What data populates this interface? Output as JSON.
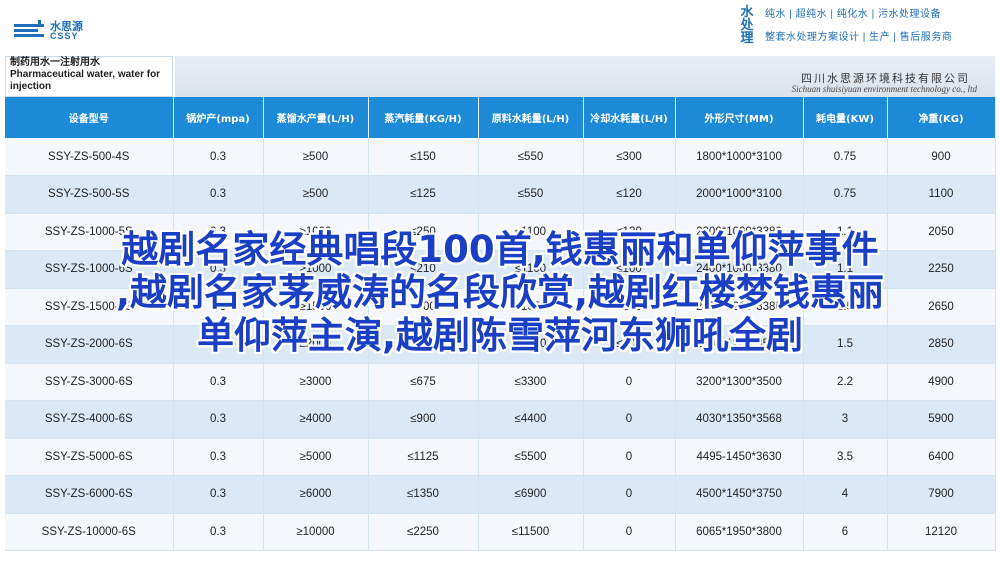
{
  "brand": {
    "name_cn": "水思源",
    "name_en": "CSSY",
    "accent": "#1e6fb8"
  },
  "services": {
    "tag": [
      "水",
      "处",
      "理"
    ],
    "line1": "纯水 | 超纯水 | 纯化水 | 污水处理设备",
    "line2": "整套水处理方案设计 | 生产 | 售后服务商"
  },
  "banner": {
    "left_title_cn": "制药用水一注射用水",
    "left_title_en_1": "Pharmaceutical water, water for",
    "left_title_en_2": "injection",
    "company_cn": "四川水思源环境科技有限公司",
    "company_en": "Sichuan shuisiyuan environment technology co., ltd"
  },
  "table": {
    "headers": [
      "设备型号",
      "锅炉产(mpa)",
      "蒸馏水产量(L/H)",
      "蒸汽耗量(KG/H)",
      "原料水耗量(L/H)",
      "冷却水耗量(L/H)",
      "外形尺寸(MM)",
      "耗电量(KW)",
      "净重(KG)"
    ],
    "rows": [
      [
        "SSY-ZS-500-4S",
        "0.3",
        "≥500",
        "≤150",
        "≤550",
        "≤300",
        "1800*1000*3100",
        "0.75",
        "900"
      ],
      [
        "SSY-ZS-500-5S",
        "0.3",
        "≥500",
        "≤125",
        "≤550",
        "≤120",
        "2000*1000*3100",
        "0.75",
        "1100"
      ],
      [
        "SSY-ZS-1000-5S",
        "0.3",
        "≥1000",
        "≤250",
        "≤1100",
        "≤120",
        "2200*1000*3380",
        "1.1",
        "2050"
      ],
      [
        "SSY-ZS-1000-6S",
        "0.3",
        "≥1000",
        "≤210",
        "≤1100",
        "≤100",
        "2400*1000*3380",
        "1.1",
        "2250"
      ],
      [
        "SSY-ZS-1500-6S",
        "0.3",
        "≥1500",
        "≤300",
        "≤1650",
        "≤150",
        "2400*1200*3380",
        "1.5",
        "2650"
      ],
      [
        "SSY-ZS-2000-6S",
        "0.3",
        "≥2000",
        "≤400",
        "≤2200",
        "≤200",
        "2600*1200*3500",
        "1.5",
        "2850"
      ],
      [
        "SSY-ZS-3000-6S",
        "0.3",
        "≥3000",
        "≤675",
        "≤3300",
        "0",
        "3200*1300*3500",
        "2.2",
        "4900"
      ],
      [
        "SSY-ZS-4000-6S",
        "0.3",
        "≥4000",
        "≤900",
        "≤4400",
        "0",
        "4030*1350*3568",
        "3",
        "5900"
      ],
      [
        "SSY-ZS-5000-6S",
        "0.3",
        "≥5000",
        "≤1125",
        "≤5500",
        "0",
        "4495-1450*3630",
        "3.5",
        "6400"
      ],
      [
        "SSY-ZS-6000-6S",
        "0.3",
        "≥6000",
        "≤1350",
        "≤6900",
        "0",
        "4500*1450*3750",
        "4",
        "7900"
      ],
      [
        "SSY-ZS-10000-6S",
        "0.3",
        "≥10000",
        "≤2250",
        "≤11500",
        "0",
        "6065*1950*3800",
        "6",
        "12120"
      ]
    ]
  },
  "overlay": {
    "line1": "越剧名家经典唱段100首,钱惠丽和单仰萍事件",
    "line2": ",越剧名家茅威涛的名段欣赏,越剧红楼梦钱惠丽",
    "line3": "单仰萍主演,越剧陈雪萍河东狮吼全剧",
    "color": "#1a3fc4"
  }
}
